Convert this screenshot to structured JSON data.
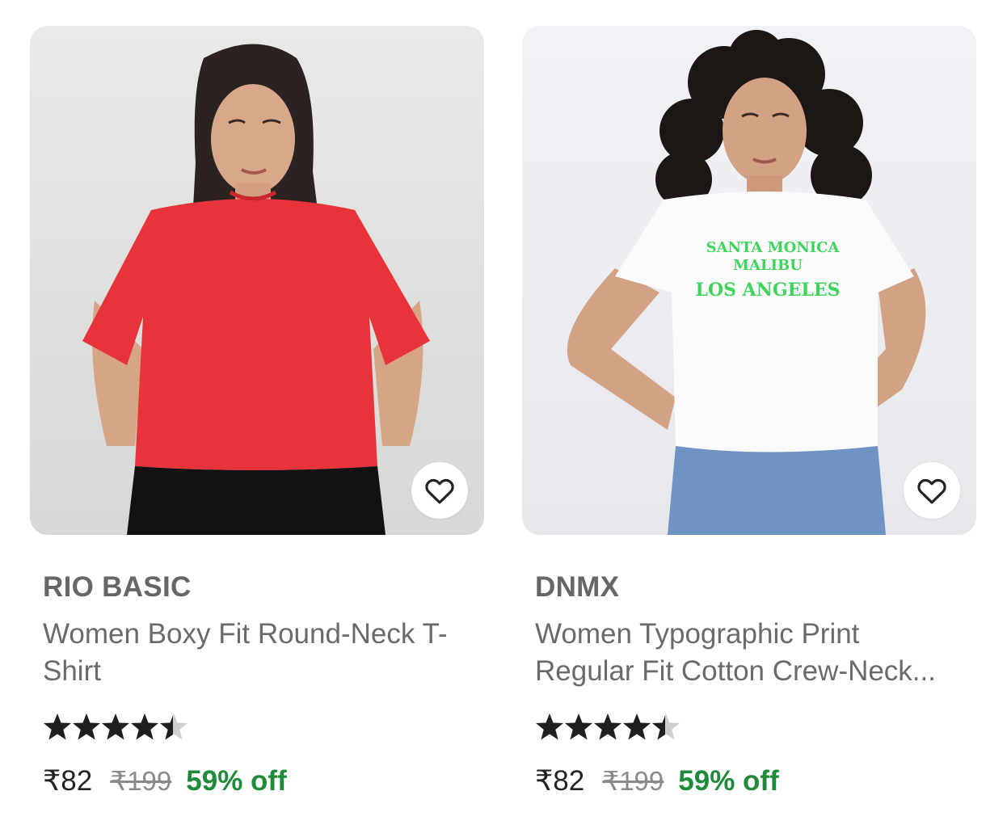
{
  "products": [
    {
      "brand": "RIO BASIC",
      "title": "Women Boxy Fit Round-Neck T-Shirt",
      "rating": 4.5,
      "price": "₹82",
      "mrp": "₹199",
      "discount": "59% off",
      "image_icon": "model-red-tshirt-photo",
      "wishlist_icon": "heart-outline-icon"
    },
    {
      "brand": "DNMX",
      "title": "Women Typographic Print Regular Fit Cotton Crew-Neck...",
      "rating": 4.5,
      "price": "₹82",
      "mrp": "₹199",
      "discount": "59% off",
      "image_icon": "model-white-tshirt-photo",
      "wishlist_icon": "heart-outline-icon",
      "print_text": [
        "SANTA MONICA",
        "MALIBU",
        "LOS ANGELES"
      ]
    }
  ],
  "colors": {
    "discount": "#1f8a3a",
    "star": "#1f1f1f",
    "star_empty": "#cfcfcf",
    "brand": "#666666"
  }
}
